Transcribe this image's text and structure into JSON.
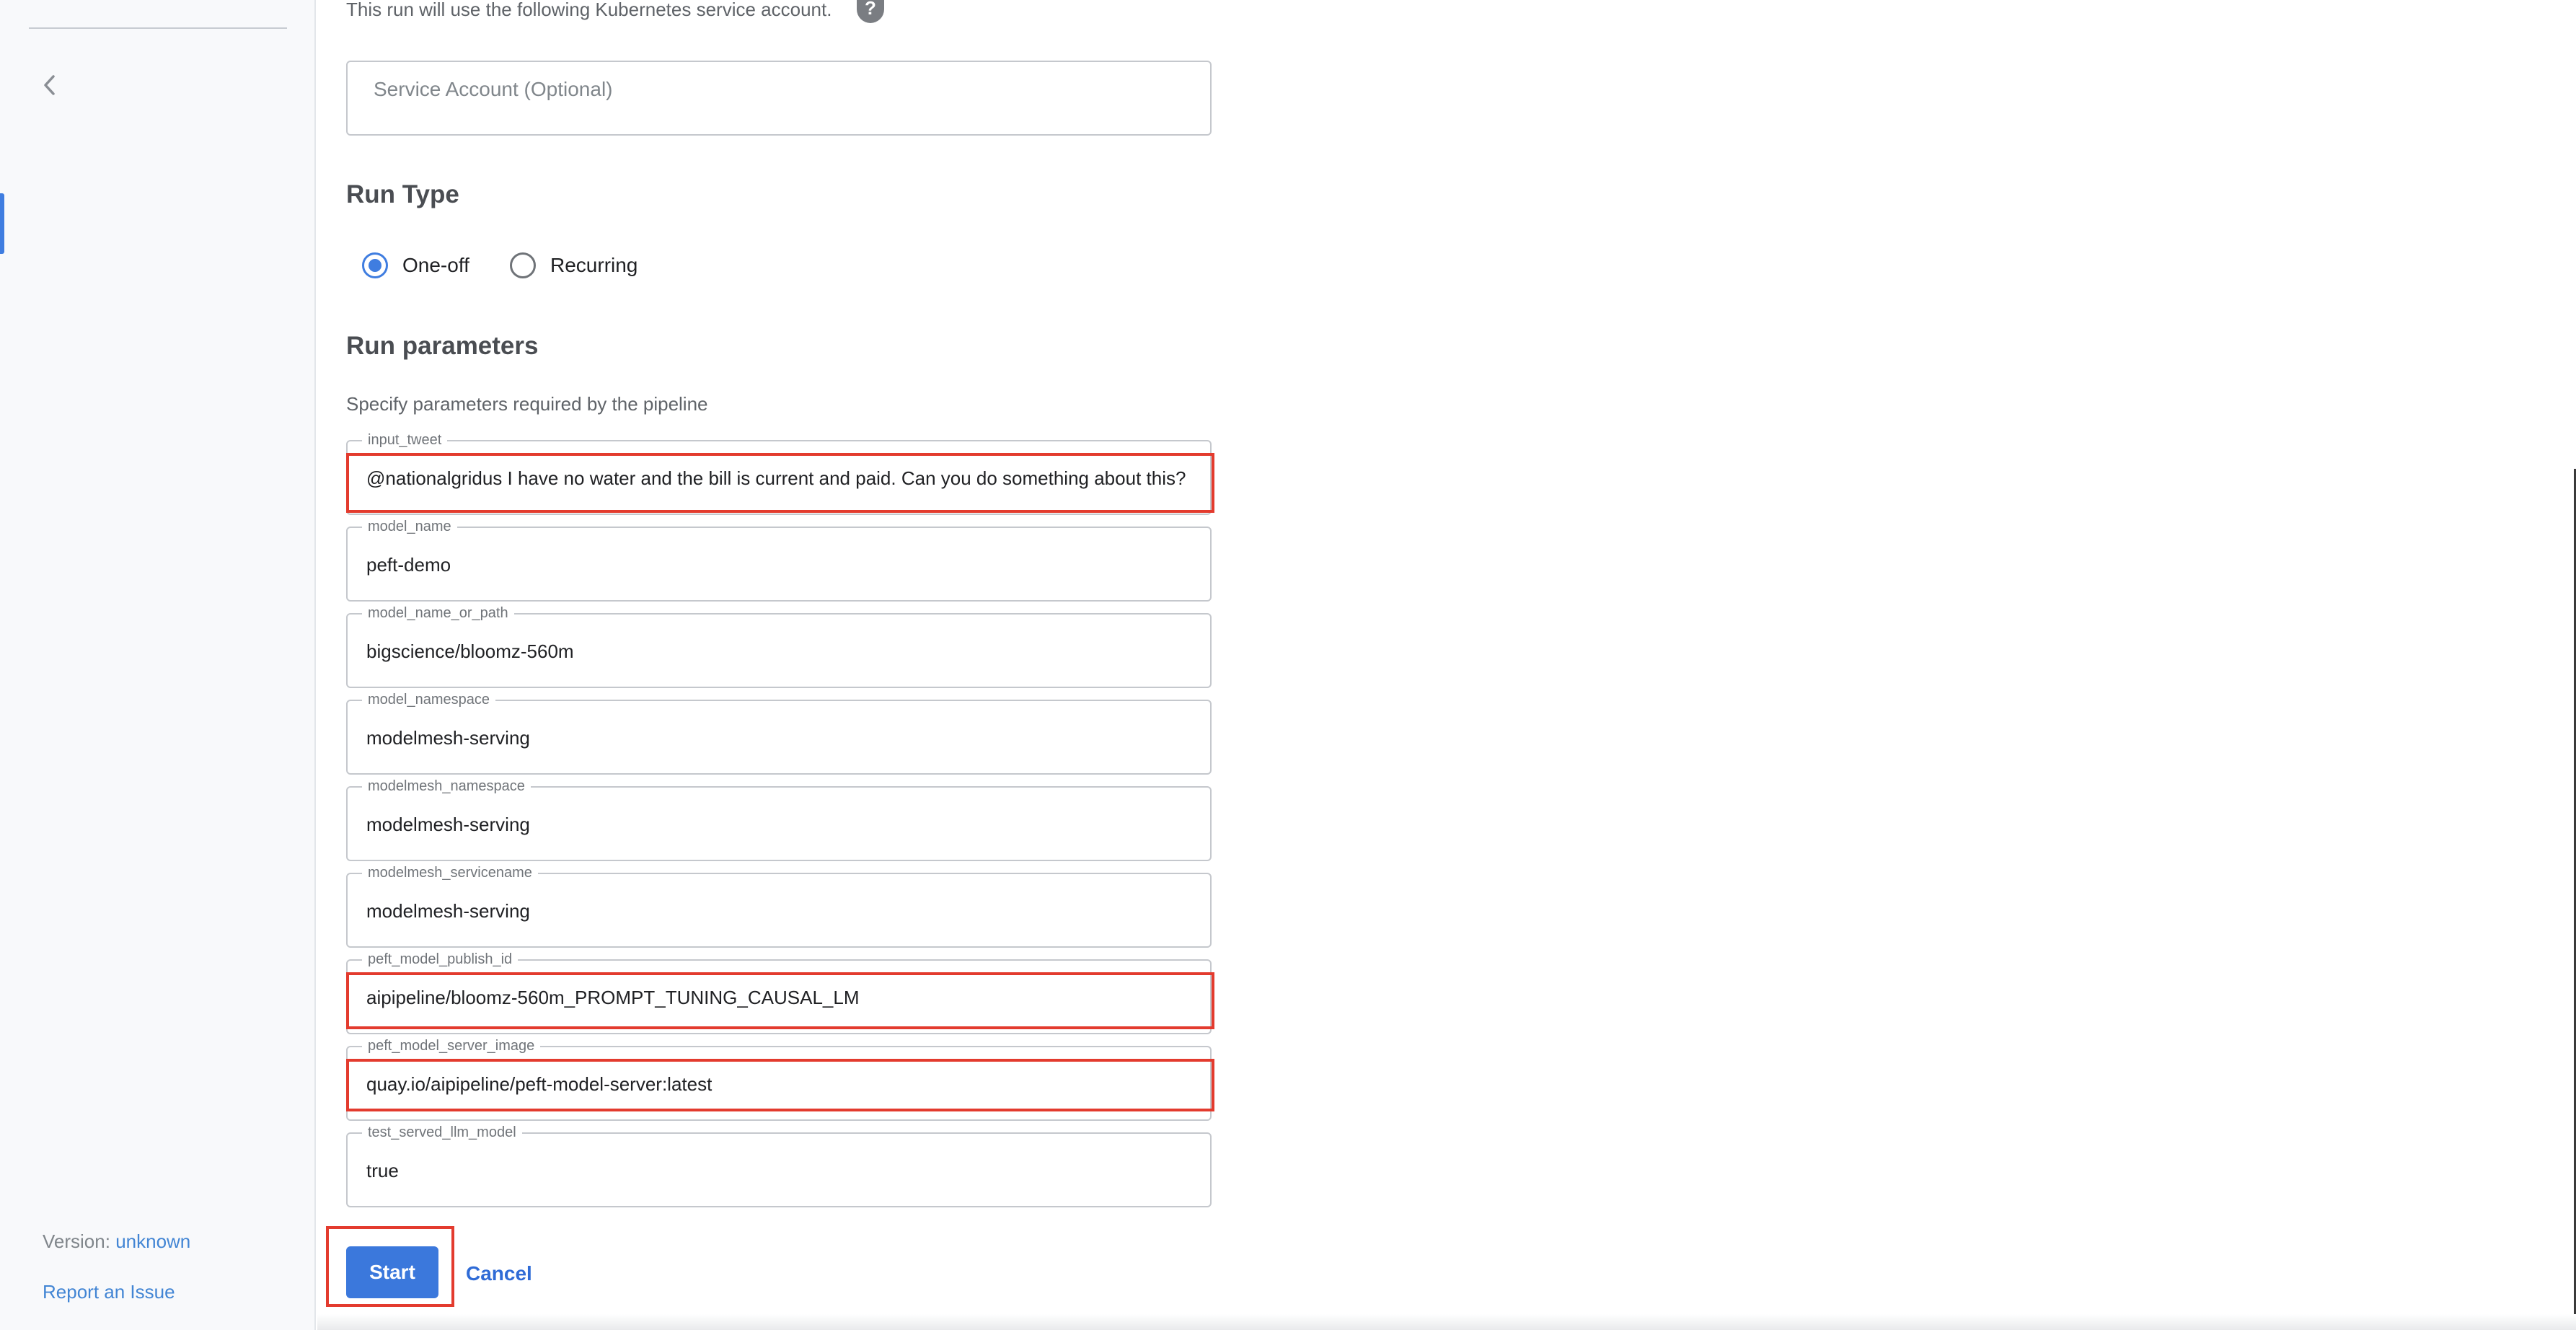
{
  "sidebar": {
    "version_label": "Version:",
    "version_value": "unknown",
    "report_link": "Report an Issue"
  },
  "service_account": {
    "description": "This run will use the following Kubernetes service account.",
    "help_icon": "?",
    "placeholder": "Service Account (Optional)"
  },
  "run_type": {
    "heading": "Run Type",
    "options": [
      {
        "label": "One-off",
        "checked": true
      },
      {
        "label": "Recurring",
        "checked": false
      }
    ]
  },
  "run_parameters": {
    "heading": "Run parameters",
    "description": "Specify parameters required by the pipeline",
    "fields": [
      {
        "name": "input_tweet",
        "value": "@nationalgridus I have no water and the bill is current and paid. Can you do something about this?"
      },
      {
        "name": "model_name",
        "value": "peft-demo"
      },
      {
        "name": "model_name_or_path",
        "value": "bigscience/bloomz-560m"
      },
      {
        "name": "model_namespace",
        "value": "modelmesh-serving"
      },
      {
        "name": "modelmesh_namespace",
        "value": "modelmesh-serving"
      },
      {
        "name": "modelmesh_servicename",
        "value": "modelmesh-serving"
      },
      {
        "name": "peft_model_publish_id",
        "value": "aipipeline/bloomz-560m_PROMPT_TUNING_CAUSAL_LM"
      },
      {
        "name": "peft_model_server_image",
        "value": "quay.io/aipipeline/peft-model-server:latest"
      },
      {
        "name": "test_served_llm_model",
        "value": "true"
      }
    ]
  },
  "actions": {
    "start_label": "Start",
    "cancel_label": "Cancel"
  },
  "colors": {
    "accent": "#3b78dc",
    "highlight": "#e33b2e"
  },
  "icons": [
    "chevron-left-icon",
    "help-icon"
  ]
}
